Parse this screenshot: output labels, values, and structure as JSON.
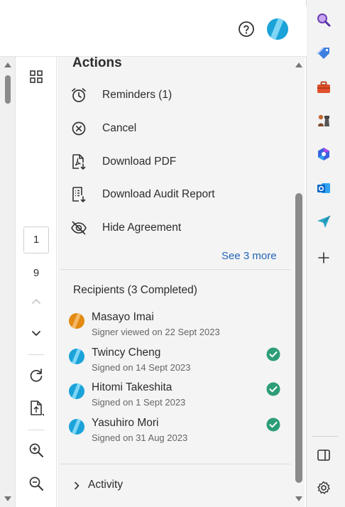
{
  "header": {
    "help_icon": "help-circle-icon",
    "avatar_colors": {
      "base": "#1ba3d9",
      "stripe": "#7fd6f5"
    }
  },
  "toolbar": {
    "current_page": "1",
    "total_pages": "9"
  },
  "actions": {
    "title": "Actions",
    "items": [
      {
        "label": "Reminders (1)",
        "icon": "alarm-clock-icon"
      },
      {
        "label": "Cancel",
        "icon": "cancel-circle-icon"
      },
      {
        "label": "Download PDF",
        "icon": "download-pdf-icon"
      },
      {
        "label": "Download Audit Report",
        "icon": "audit-report-icon"
      },
      {
        "label": "Hide Agreement",
        "icon": "eye-off-icon"
      }
    ],
    "see_more": "See 3 more"
  },
  "recipients": {
    "title": "Recipients (3 Completed)",
    "items": [
      {
        "name": "Masayo Imai",
        "status": "Signer viewed on 22 Sept 2023",
        "completed": false,
        "color": "#e38a12"
      },
      {
        "name": "Twincy Cheng",
        "status": "Signed on 14 Sept 2023",
        "completed": true,
        "color": "#1ba3d9"
      },
      {
        "name": "Hitomi Takeshita",
        "status": "Signed on 1 Sept 2023",
        "completed": true,
        "color": "#1ba3d9"
      },
      {
        "name": "Yasuhiro Mori",
        "status": "Signed on 31 Aug 2023",
        "completed": true,
        "color": "#1ba3d9"
      }
    ]
  },
  "activity": {
    "label": "Activity"
  },
  "colors": {
    "link": "#2364b8",
    "check": "#2d9d78"
  }
}
